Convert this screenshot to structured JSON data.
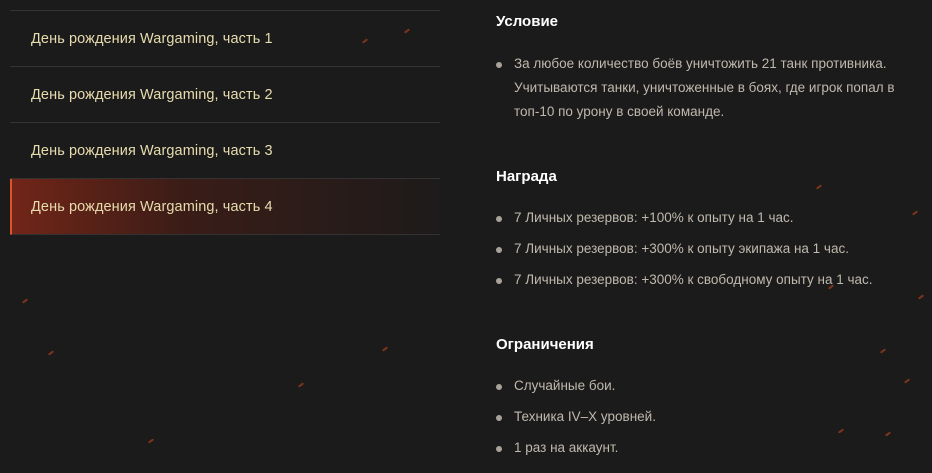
{
  "missions": [
    {
      "label": "День рождения Wargaming, часть 1"
    },
    {
      "label": "День рождения Wargaming, часть 2"
    },
    {
      "label": "День рождения Wargaming, часть 3"
    },
    {
      "label": "День рождения Wargaming, часть 4"
    }
  ],
  "condition": {
    "title": "Условие",
    "items": [
      "За любое количество боёв уничтожить 21 танк противника. Учитываются танки, уничтоженные в боях, где игрок попал в топ-10 по урону в своей команде."
    ]
  },
  "reward": {
    "title": "Награда",
    "items": [
      "7 Личных резервов: +100% к опыту на 1 час.",
      "7 Личных резервов: +300% к опыту экипажа на 1 час.",
      "7 Личных резервов: +300% к свободному опыту на 1 час."
    ]
  },
  "restrictions": {
    "title": "Ограничения",
    "items": [
      "Случайные бои.",
      "Техника IV–X уровней.",
      "1 раз на аккаунт."
    ]
  },
  "colors": {
    "background": "#1c1b1b",
    "accent": "#d9562a",
    "mission_text": "#e7dcae",
    "body_text": "#bfb9ad"
  }
}
